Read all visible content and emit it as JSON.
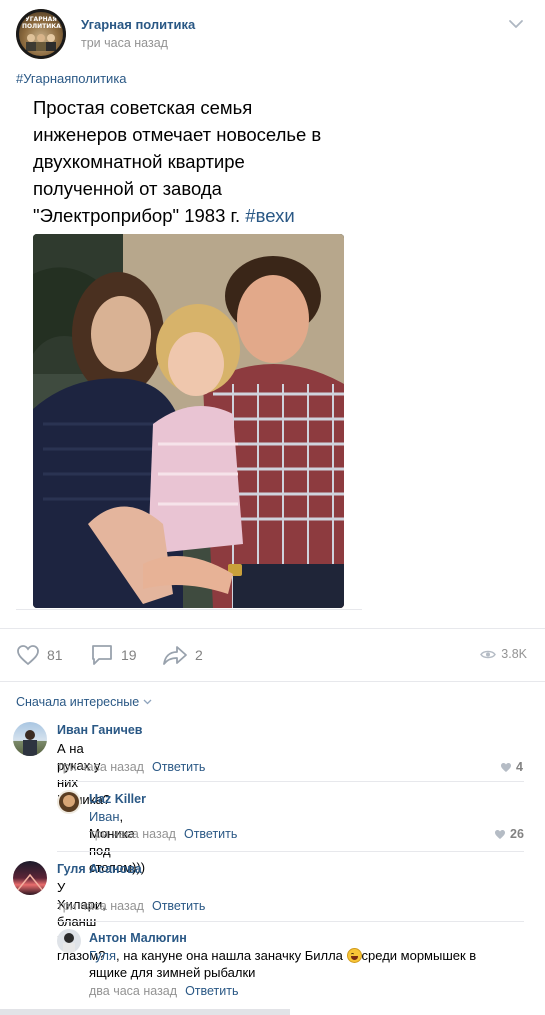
{
  "post": {
    "group_name": "Угарная политика",
    "time": "три часа назад",
    "avatar_text": "УГАРНАЯ ПОЛИТИКА",
    "hashtag": "#Угарнаяполитика",
    "text_lines": [
      "Простая советская семья",
      "инженеров отмечает новоселье в",
      "двухкомнатной квартире",
      "полученной от завода",
      "\"Электроприбор\" 1983 г."
    ],
    "text_tag": "#вехи"
  },
  "actions": {
    "likes": "81",
    "comments": "19",
    "shares": "2",
    "views": "3.8K",
    "icons": [
      "heart-icon",
      "comment-icon",
      "share-icon",
      "eye-icon"
    ]
  },
  "sort_label": "Сначала интересные",
  "reply_label": "Ответить",
  "comments": [
    {
      "name": "Иван Ганичев",
      "text": "А на руках у них Моника?",
      "time": "три часа назад",
      "likes": "4"
    },
    {
      "name": "Uaz Killer",
      "mention": "Иван",
      "text": ", Моника под столом)))",
      "time": "три часа назад",
      "likes": "26"
    },
    {
      "name": "Гуля Асанова",
      "text": "У Хилари, бланш под глазом?",
      "time": "три часа назад",
      "likes": ""
    },
    {
      "name": "Антон Малюгин",
      "mention": "Гуля",
      "text_before_emoji": ", на кануне она нашла заначку Билла ",
      "text_after_emoji": "среди мормышек в ящике для зимней рыбалки",
      "time": "два часа назад",
      "likes": ""
    }
  ],
  "colors": {
    "link": "#2a5885",
    "muted": "#939393",
    "divider": "#e7e8ec",
    "tag": "#2a8fd1"
  }
}
